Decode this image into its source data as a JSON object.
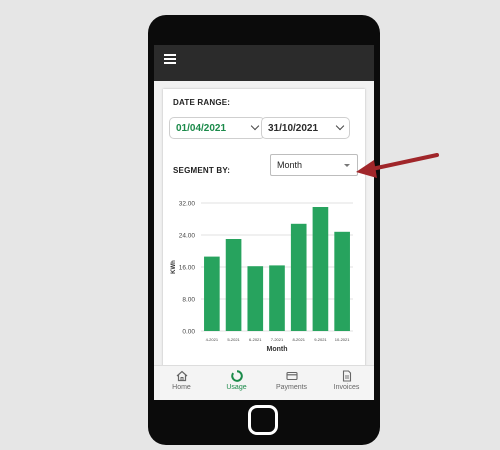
{
  "filters": {
    "date_range_label": "DATE RANGE:",
    "start_date": "01/04/2021",
    "end_date": "31/10/2021",
    "segment_by_label": "SEGMENT BY:",
    "segment_by_value": "Month"
  },
  "colors": {
    "accent": "#1b8a4a",
    "bar": "#27a35e",
    "annotation_arrow": "#a0262a"
  },
  "chart_data": {
    "type": "bar",
    "categories": [
      "4-2021",
      "5-2021",
      "6-2021",
      "7-2021",
      "8-2021",
      "9-2021",
      "10-2021"
    ],
    "values": [
      18.6,
      23.0,
      16.2,
      16.4,
      26.8,
      31.0,
      24.8
    ],
    "xlabel": "Month",
    "ylabel": "KWh",
    "ylim": [
      0,
      32
    ],
    "yticks": [
      "0.00",
      "8.00",
      "16.00",
      "24.00",
      "32.00"
    ],
    "grid": true
  },
  "bottom_nav": [
    {
      "label": "Home",
      "icon": "home-icon",
      "active": false
    },
    {
      "label": "Usage",
      "icon": "usage-ring-icon",
      "active": true
    },
    {
      "label": "Payments",
      "icon": "card-icon",
      "active": false
    },
    {
      "label": "Invoices",
      "icon": "document-icon",
      "active": false
    }
  ]
}
